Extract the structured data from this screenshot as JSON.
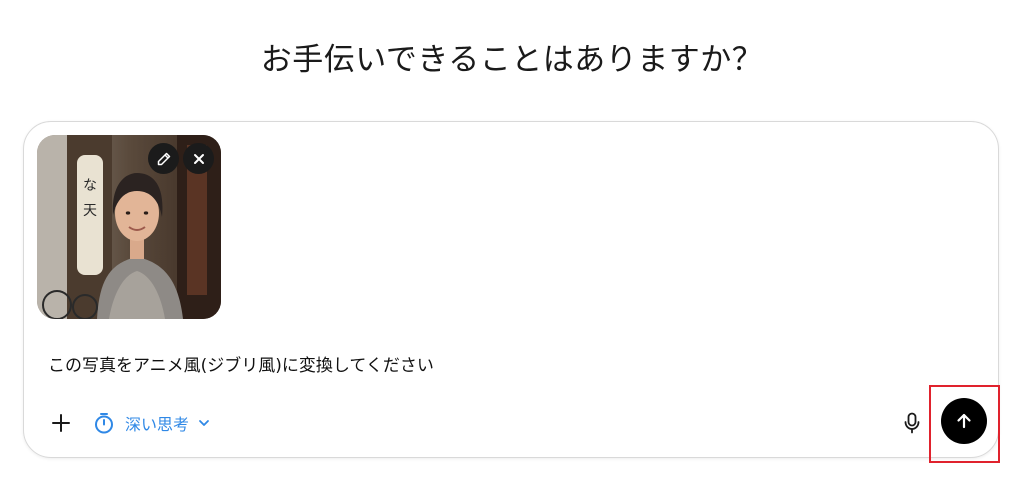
{
  "heading": "お手伝いできることはありますか？",
  "composer": {
    "prompt_text": "この写真をアニメ風(ジブリ風)に変換してください",
    "attachment": {
      "edit_icon": "pencil-icon",
      "remove_icon": "close-icon"
    },
    "toolbar": {
      "add_icon": "plus-icon",
      "think_label": "深い思考",
      "think_icon": "timer-icon",
      "think_chevron_icon": "chevron-down-icon",
      "mic_icon": "microphone-icon",
      "send_icon": "arrow-up-icon"
    }
  },
  "colors": {
    "accent_blue": "#2f88e6",
    "send_button": "#000000",
    "highlight_red": "#e0222d"
  }
}
